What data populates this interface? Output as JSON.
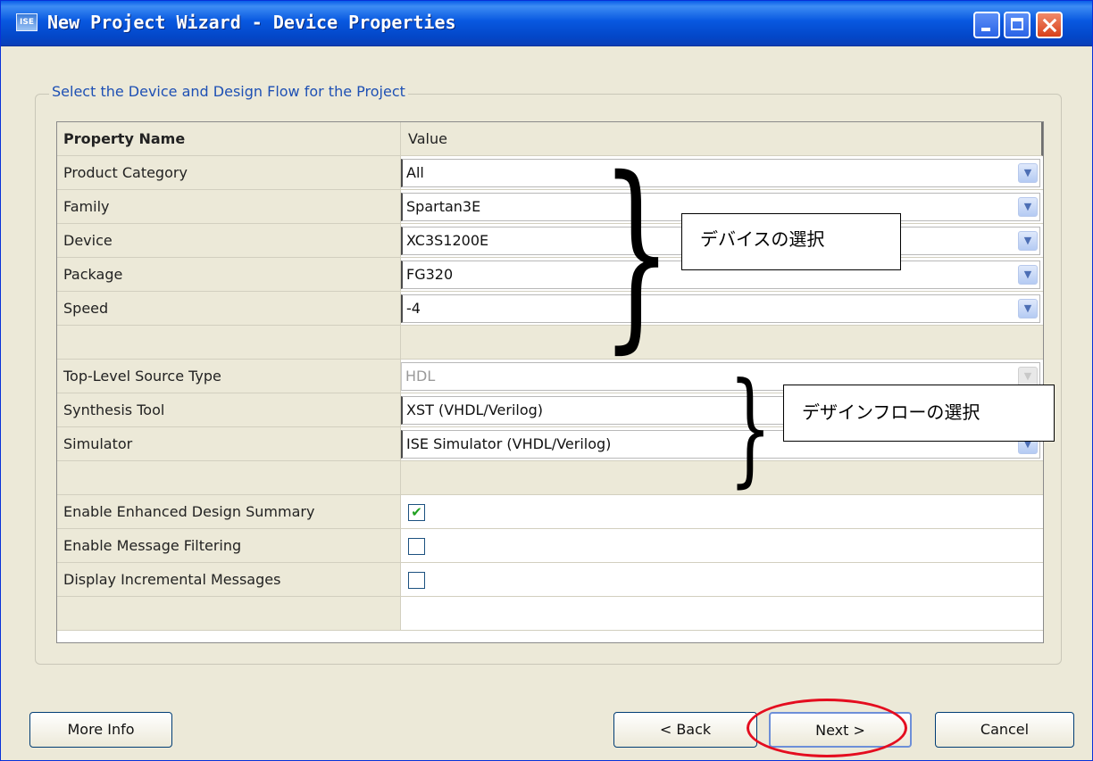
{
  "window": {
    "icon_text": "ISE",
    "title": "New Project Wizard - Device Properties"
  },
  "group": {
    "label": "Select the Device and Design Flow for the Project"
  },
  "table": {
    "header": {
      "name": "Property Name",
      "value": "Value"
    },
    "rows": [
      {
        "name": "Product Category",
        "value": "All"
      },
      {
        "name": "Family",
        "value": "Spartan3E"
      },
      {
        "name": "Device",
        "value": "XC3S1200E"
      },
      {
        "name": "Package",
        "value": "FG320"
      },
      {
        "name": "Speed",
        "value": "-4"
      },
      {
        "name": "Top-Level Source Type",
        "value": "HDL"
      },
      {
        "name": "Synthesis Tool",
        "value": "XST (VHDL/Verilog)"
      },
      {
        "name": "Simulator",
        "value": "ISE Simulator (VHDL/Verilog)"
      },
      {
        "name": "Enable Enhanced Design Summary",
        "checked": true
      },
      {
        "name": "Enable Message Filtering",
        "checked": false
      },
      {
        "name": "Display Incremental Messages",
        "checked": false
      }
    ]
  },
  "annotations": {
    "device_selection": "デバイスの選択",
    "design_flow_selection": "デザインフローの選択"
  },
  "buttons": {
    "more_info": "More Info",
    "back": "< Back",
    "next": "Next >",
    "cancel": "Cancel"
  },
  "colors": {
    "title_bar": "#0a5ee8",
    "highlight_ring": "#e40d1f",
    "group_label": "#1e50b4"
  }
}
